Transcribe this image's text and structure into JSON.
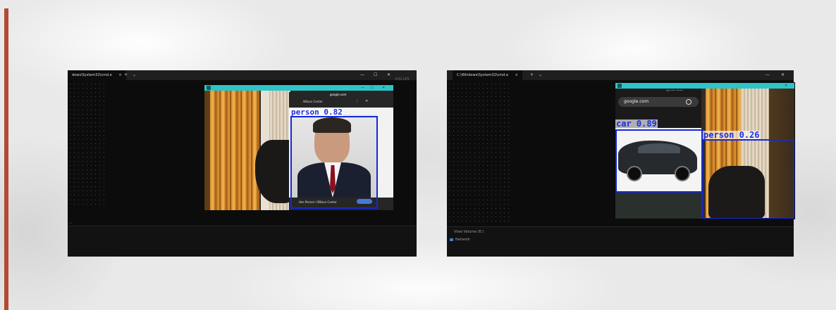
{
  "colors": {
    "accent_bar": "#b34a32",
    "detection_title": "#2ec4c9",
    "box": "#1428d8",
    "label": "#1c2ee8"
  },
  "terminal_left": {
    "tab_title": "dows\\System32\\cmd.e",
    "tab_close": "×",
    "new_tab": "+",
    "dropdown": "⌄",
    "minimize": "—",
    "maximize": "☐",
    "close": "✕",
    "edge_text": "VISCLES",
    "status": "..."
  },
  "terminal_right": {
    "tab_title": "C:\\Windows\\System32\\cmd.e",
    "tab_close": "×",
    "new_tab": "+",
    "dropdown": "⌄",
    "minimize": "—",
    "close": "✕",
    "footer_item_1": "View Volume (E:)",
    "footer_item_2": "Network"
  },
  "detection_left": {
    "window_ctrl_min": "—",
    "window_ctrl_max": "☐",
    "window_ctrl_close": "✕",
    "phone_url": "google.com",
    "phone_header": "Wilson Center",
    "phone_menu": "⋮",
    "phone_close": "✕",
    "phone_caption": "Hes Persen I Wilson Center",
    "detections": [
      {
        "label": "person 0.82"
      }
    ]
  },
  "detection_right": {
    "window_ctrl_close": "✕",
    "phone_status": "ca  ••• ••••",
    "phone_url": "google.com",
    "detections": [
      {
        "label": "car 0.89"
      },
      {
        "label": "person 0.26"
      }
    ]
  }
}
